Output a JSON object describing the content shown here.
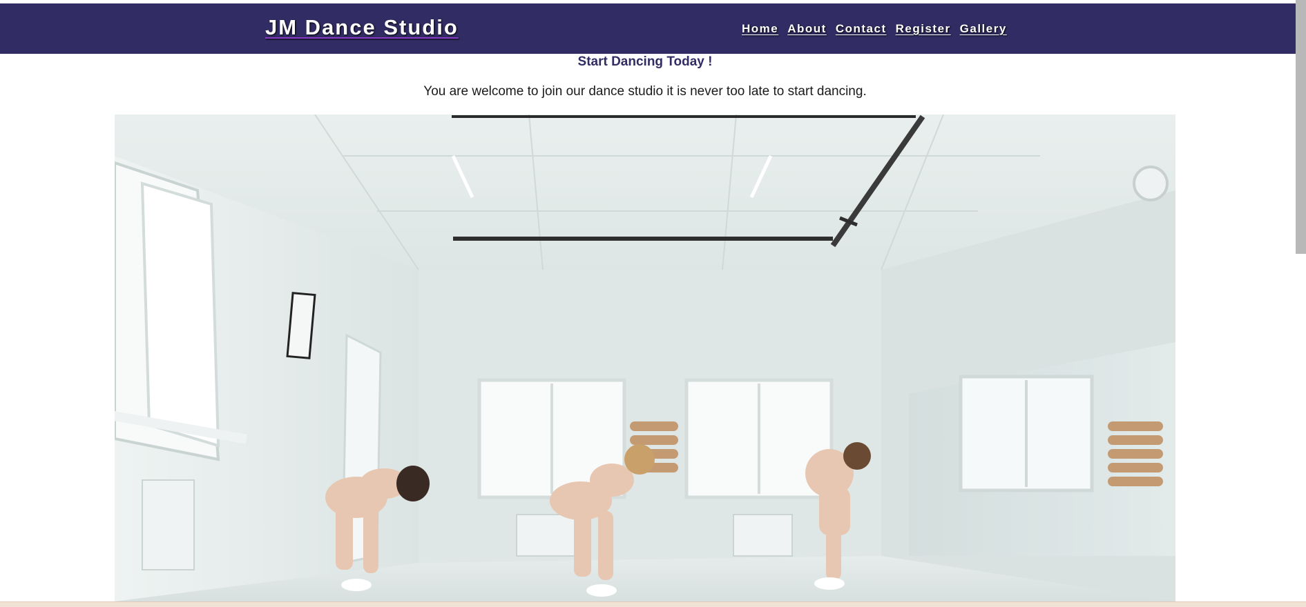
{
  "header": {
    "brand": "JM Dance Studio",
    "nav": [
      {
        "label": "Home"
      },
      {
        "label": "About"
      },
      {
        "label": "Contact"
      },
      {
        "label": "Register"
      },
      {
        "label": "Gallery"
      }
    ]
  },
  "main": {
    "headline": "Start Dancing Today !",
    "intro": "You are welcome to join our dance studio it is never too late to start dancing."
  },
  "colors": {
    "navbar": "#312c63",
    "headline": "#312c63",
    "nav_text": "#ffffff"
  }
}
